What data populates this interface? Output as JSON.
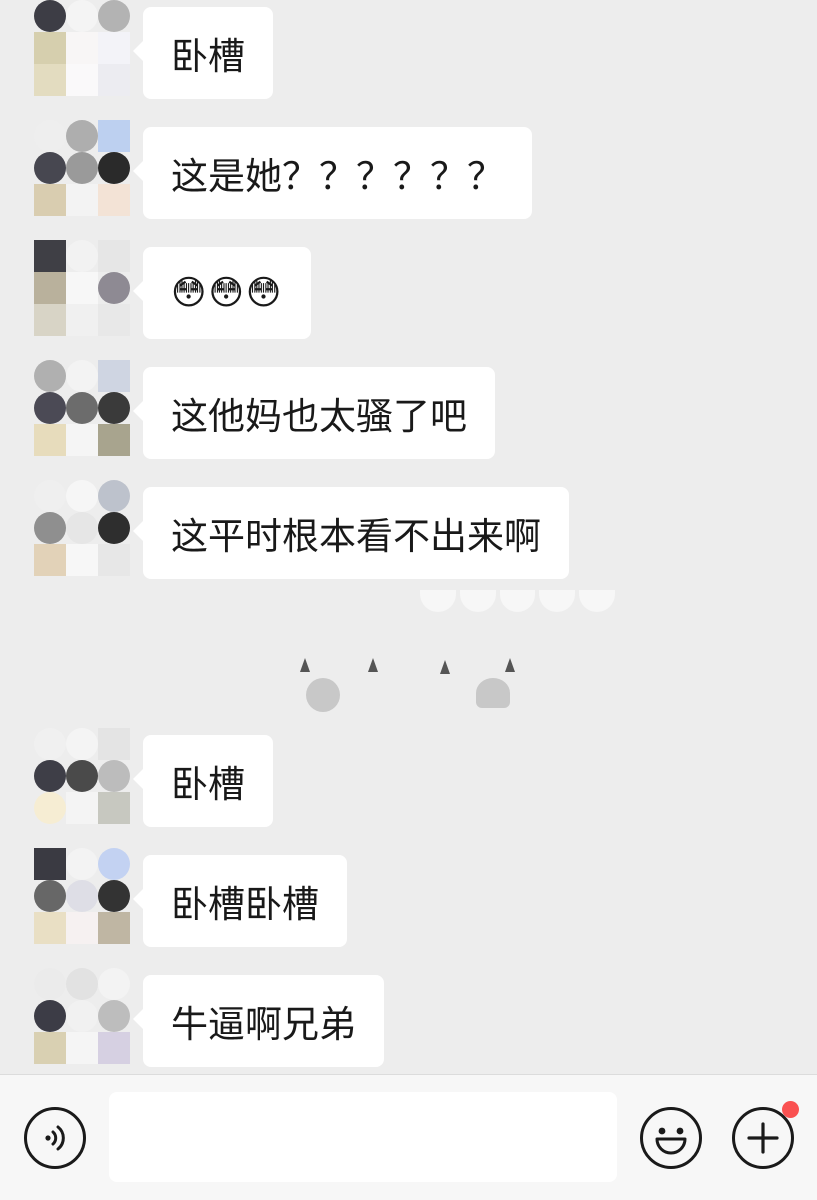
{
  "messages": [
    {
      "text": "卧槽"
    },
    {
      "text": "这是她？？？？？？"
    },
    {
      "text": "😳😳😳"
    },
    {
      "text": "这他妈也太骚了吧"
    },
    {
      "text": "这平时根本看不出来啊"
    },
    {
      "text": "卧槽"
    },
    {
      "text": "卧槽卧槽"
    },
    {
      "text": "牛逼啊兄弟"
    }
  ],
  "input": {
    "placeholder": ""
  },
  "icons": {
    "voice": "voice-icon",
    "emoji": "smiley-icon",
    "more": "plus-icon"
  },
  "colors": {
    "background": "#ededed",
    "bubble": "#ffffff",
    "badge": "#fa5151"
  }
}
